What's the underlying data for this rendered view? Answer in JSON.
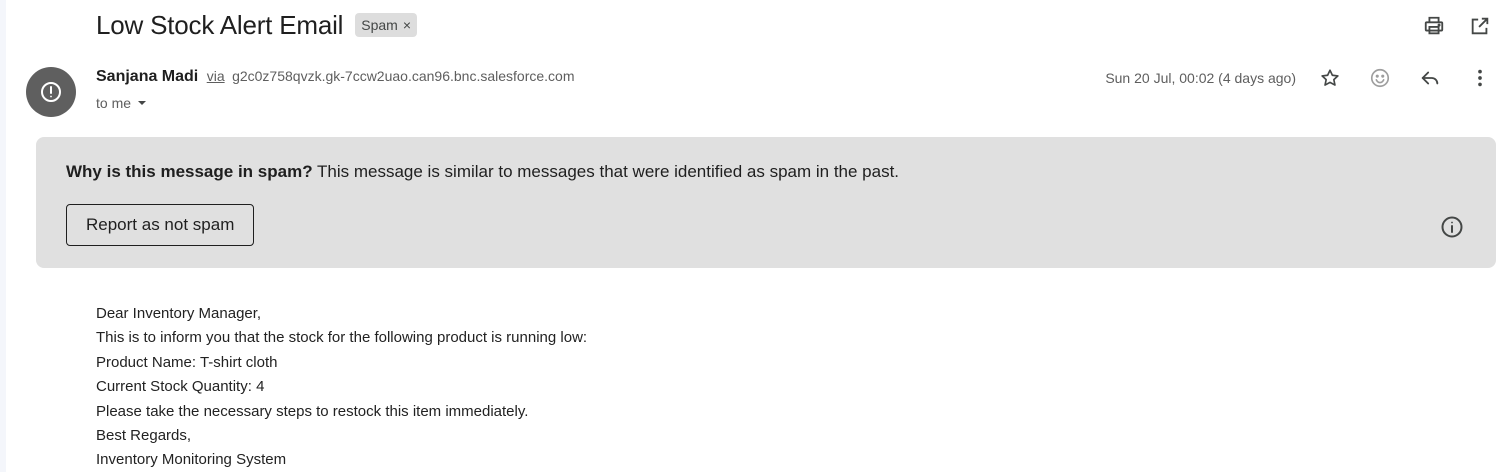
{
  "email": {
    "subject": "Low Stock Alert Email",
    "label": "Spam",
    "label_remove": "×",
    "sender_name": "Sanjana Madi",
    "via_label": "via",
    "via_domain": "g2c0z758qvzk.gk-7ccw2uao.can96.bnc.salesforce.com",
    "to_label": "to me",
    "date": "Sun 20 Jul, 00:02 (4 days ago)"
  },
  "spam_banner": {
    "question": "Why is this message in spam?",
    "explanation": "This message is similar to messages that were identified as spam in the past.",
    "button_label": "Report as not spam"
  },
  "body": {
    "lines": [
      "Dear Inventory Manager,",
      "This is to inform you that the stock for the following product is running low:",
      "Product Name: T-shirt cloth",
      "Current Stock Quantity: 4",
      "Please take the necessary steps to restock this item immediately.",
      "Best Regards,",
      "Inventory Monitoring System"
    ]
  },
  "icons": {
    "top": [
      "print-icon",
      "open-in-new-window-icon"
    ],
    "message": [
      "star-icon",
      "emoji-reaction-icon",
      "reply-icon",
      "more-vert-icon"
    ],
    "avatar": "warning-icon",
    "info": "info-icon"
  },
  "colors": {
    "banner_bg": "#e0e0e0",
    "avatar_bg": "#5f5f5f",
    "chip_bg": "#dddddd"
  }
}
